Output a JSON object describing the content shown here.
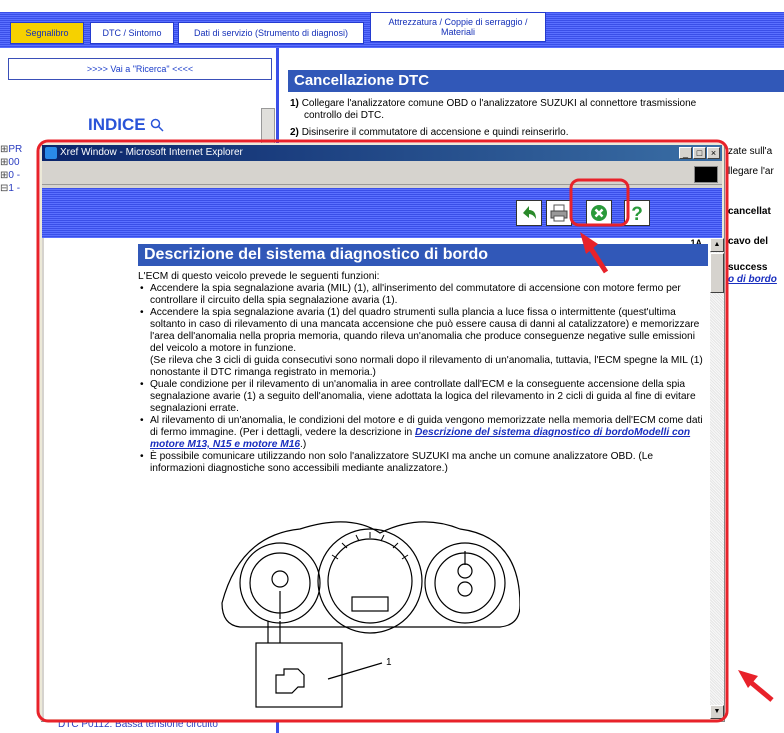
{
  "tabs": [
    {
      "label": "Segnalibro",
      "active": true
    },
    {
      "label": "DTC / Sintomo",
      "active": false
    },
    {
      "label": "Dati di servizio (Strumento di diagnosi)",
      "active": false
    },
    {
      "label": "Attrezzatura / Coppie di serraggio / Materiali",
      "active": false
    }
  ],
  "left": {
    "search_link": ">>>> Vai a \"Ricerca\" <<<<",
    "index_title": "INDICE",
    "tree": [
      "PR",
      "00",
      "0 -",
      "1 -"
    ],
    "bottom_link": "DTC P0112: Bassa tensione circuito"
  },
  "main": {
    "title": "Cancellazione DTC",
    "step1_num": "1)",
    "step1_a": "Collegare l'analizzatore comune OBD o l'analizzatore SUZUKI al connettore trasmissione",
    "step1_b": "controllo dei DTC.",
    "step2_num": "2)",
    "step2": "Disinserire il commutatore di accensione e quindi reinserirlo.",
    "frag1": "zate sull'a",
    "frag2": "llegare l'ar",
    "frag3": "cancellat",
    "frag4": "cavo del",
    "frag5": "success",
    "frag6": "o di bordo"
  },
  "popup": {
    "title": "Xref Window - Microsoft Internet Explorer",
    "page_id": "1A",
    "heading": "Descrizione del sistema diagnostico di bordo",
    "intro": "L'ECM di questo veicolo prevede le seguenti funzioni:",
    "b1": "Accendere la spia segnalazione avaria (MIL) (1), all'inserimento del commutatore di accensione con motore fermo per controllare il circuito della spia segnalazione avaria (1).",
    "b2a": "Accendere la spia segnalazione avaria (1) del quadro strumenti sulla plancia a luce fissa o intermittente (quest'ultima soltanto in caso di rilevamento di una mancata accensione che può essere causa di danni al catalizzatore) e memorizzare l'area dell'anomalia nella propria memoria, quando rileva un'anomalia che produce conseguenze negative sulle emissioni del veicolo a motore in funzione.",
    "b2b": "(Se rileva che 3 cicli di guida consecutivi sono normali dopo il rilevamento di un'anomalia, tuttavia, l'ECM spegne la MIL (1) nonostante il DTC rimanga registrato in memoria.)",
    "b3": "Quale condizione per il rilevamento di un'anomalia in aree controllate dall'ECM e la conseguente accensione della spia segnalazione avarie (1) a seguito dell'anomalia, viene adottata la logica del rilevamento in 2 cicli di guida al fine di evitare segnalazioni errate.",
    "b4_pre": "Al rilevamento di un'anomalia, le condizioni del motore e di guida vengono memorizzate nella memoria dell'ECM come dati di fermo immagine. (Per i dettagli, vedere la descrizione in ",
    "b4_link": "Descrizione del sistema diagnostico di bordoModelli con motore M13, N15 e motore M16",
    "b4_post": ".)",
    "b5": "È possibile comunicare utilizzando non solo l'analizzatore SUZUKI ma anche un comune analizzatore OBD. (Le informazioni diagnostiche sono accessibili mediante analizzatore.)",
    "fig_label": "1"
  },
  "colors": {
    "accent": "#3158b8",
    "highlight": "#e8222a",
    "tab_active": "#f6d100"
  }
}
